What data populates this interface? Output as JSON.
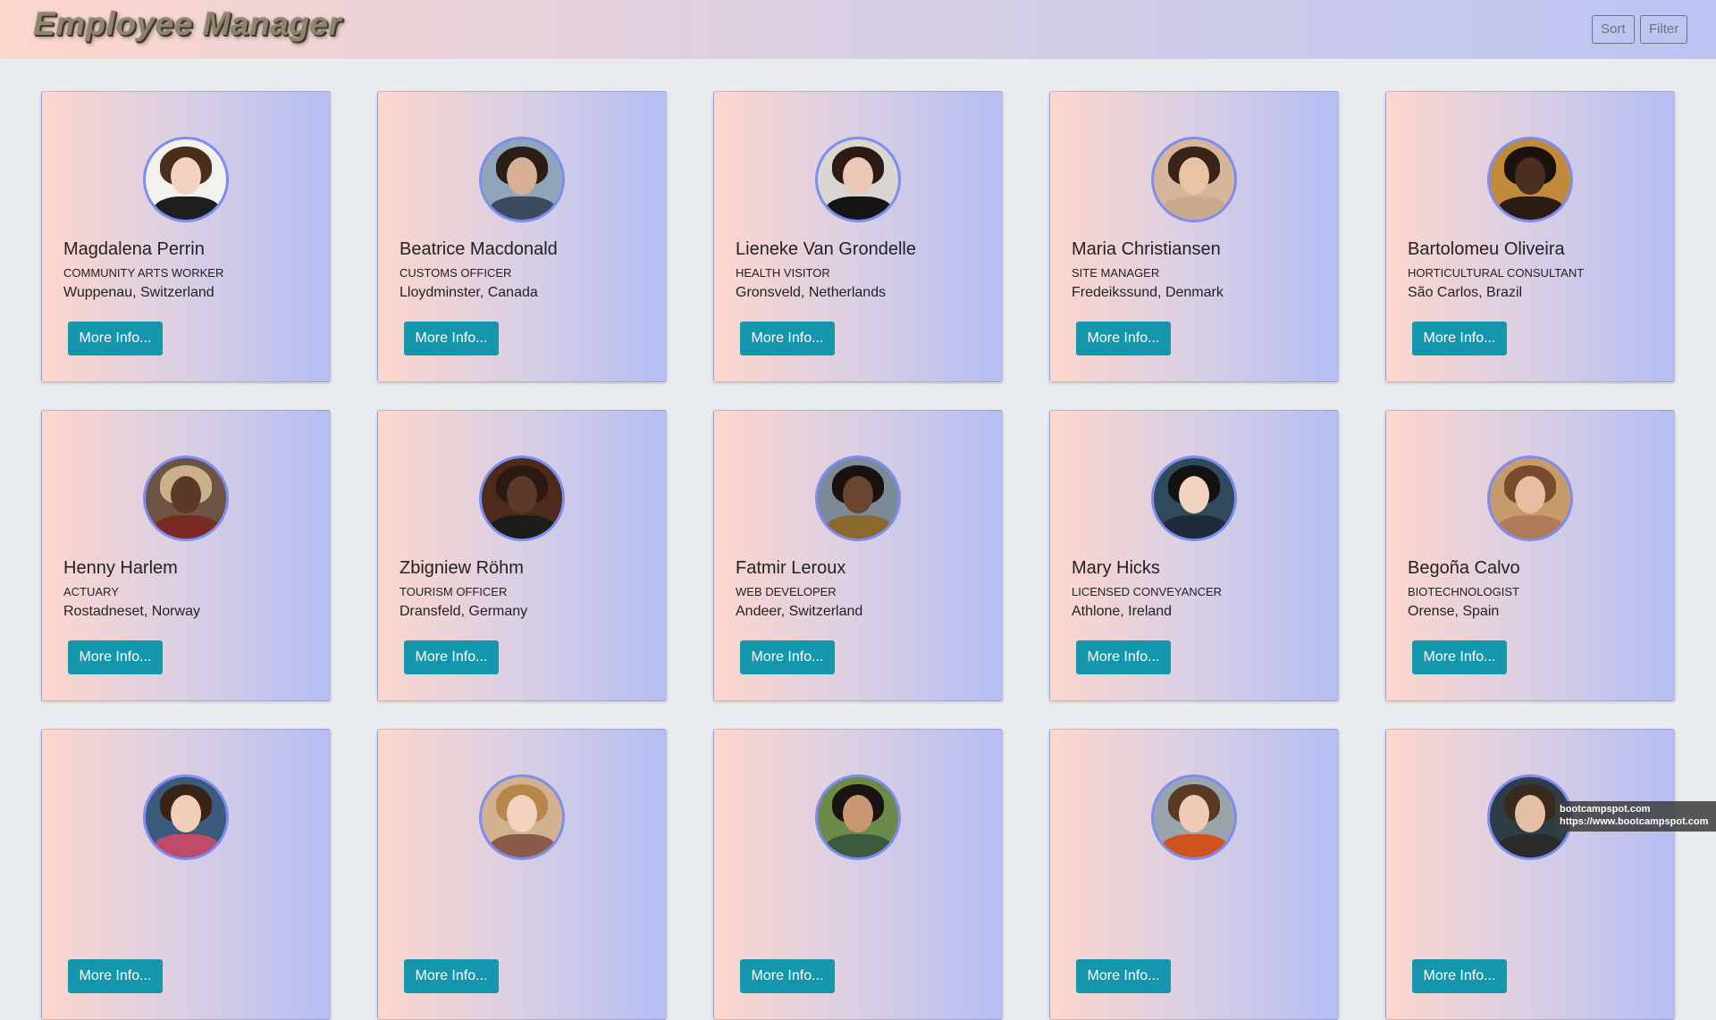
{
  "navbar": {
    "brand": "Employee Manager",
    "sort_label": "Sort",
    "filter_label": "Filter"
  },
  "more_info_label": "More Info...",
  "employees": [
    {
      "name": "Magdalena Perrin",
      "title": "Community Arts Worker",
      "location": "Wuppenau, Switzerland",
      "skin": "#f1d2bd",
      "hair": "#4a2e1e",
      "shirt": "#1e1e1e",
      "bg": "#f3f1ee"
    },
    {
      "name": "Beatrice Macdonald",
      "title": "Customs Officer",
      "location": "Lloydminster, Canada",
      "skin": "#d8b094",
      "hair": "#2b1e18",
      "shirt": "#3c4a5e",
      "bg": "#8fa6ba"
    },
    {
      "name": "Lieneke Van Grondelle",
      "title": "Health Visitor",
      "location": "Gronsveld, Netherlands",
      "skin": "#ecc7b4",
      "hair": "#2c1a14",
      "shirt": "#151515",
      "bg": "#d9d6d2"
    },
    {
      "name": "Maria Christiansen",
      "title": "Site Manager",
      "location": "Fredeikssund, Denmark",
      "skin": "#e9c3a3",
      "hair": "#3a2418",
      "shirt": "#c9a98c",
      "bg": "#d6b69a"
    },
    {
      "name": "Bartolomeu Oliveira",
      "title": "Horticultural Consultant",
      "location": "São Carlos, Brazil",
      "skin": "#4a2f20",
      "hair": "#1c120c",
      "shirt": "#2b1d14",
      "bg": "#c08a3a"
    },
    {
      "name": "Henny Harlem",
      "title": "Actuary",
      "location": "Rostadneset, Norway",
      "skin": "#5a3926",
      "hair": "#c9b28a",
      "shirt": "#7a2b24",
      "bg": "#6c5344"
    },
    {
      "name": "Zbigniew Röhm",
      "title": "Tourism Officer",
      "location": "Dransfeld, Germany",
      "skin": "#5b3a27",
      "hair": "#2a1a12",
      "shirt": "#1c1c1c",
      "bg": "#4e2a1c"
    },
    {
      "name": "Fatmir Leroux",
      "title": "Web Developer",
      "location": "Andeer, Switzerland",
      "skin": "#6a4630",
      "hair": "#1a120c",
      "shirt": "#8a6a2c",
      "bg": "#7b8a99"
    },
    {
      "name": "Mary Hicks",
      "title": "Licensed Conveyancer",
      "location": "Athlone, Ireland",
      "skin": "#f0d3bf",
      "hair": "#121212",
      "shirt": "#1e2a3a",
      "bg": "#2f4a5a"
    },
    {
      "name": "Begoña Calvo",
      "title": "Biotechnologist",
      "location": "Orense, Spain",
      "skin": "#e7bea1",
      "hair": "#7a4a2c",
      "shirt": "#b07a5a",
      "bg": "#c79a6c"
    },
    {
      "name": "",
      "title": "",
      "location": "",
      "skin": "#f0cfb8",
      "hair": "#3a2418",
      "shirt": "#c04a6a",
      "bg": "#3c5a7c"
    },
    {
      "name": "",
      "title": "",
      "location": "",
      "skin": "#f1d3bd",
      "hair": "#b8864a",
      "shirt": "#8a5a4a",
      "bg": "#d4b18e"
    },
    {
      "name": "",
      "title": "",
      "location": "",
      "skin": "#c99873",
      "hair": "#1a1410",
      "shirt": "#3c5a3c",
      "bg": "#6c8a4a"
    },
    {
      "name": "",
      "title": "",
      "location": "",
      "skin": "#efcbb3",
      "hair": "#5a3a24",
      "shirt": "#d0521c",
      "bg": "#9aa4ac"
    },
    {
      "name": "",
      "title": "",
      "location": "",
      "skin": "#e4bfa4",
      "hair": "#3a2a1c",
      "shirt": "#2a2a2a",
      "bg": "#2e3c46"
    }
  ],
  "watermark": {
    "line1": "bootcampspot.com",
    "line2": "https://www.bootcampspot.com"
  }
}
